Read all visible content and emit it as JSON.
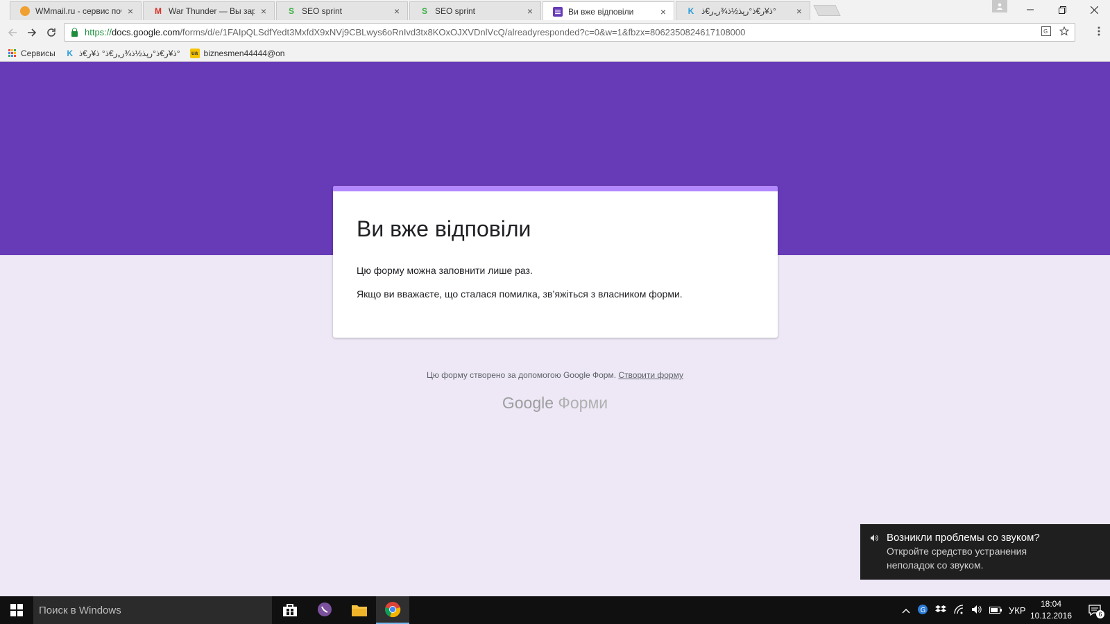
{
  "browser": {
    "tabs": [
      {
        "title": "WMmail.ru - сервис поч",
        "icon": "wmmail-icon",
        "color": "#f0a030"
      },
      {
        "title": "War Thunder — Вы заре",
        "icon": "gmail-icon",
        "color": "#d93025"
      },
      {
        "title": "SEO sprint",
        "icon": "seosprint-icon",
        "color": "#3cb043"
      },
      {
        "title": "SEO sprint",
        "icon": "seosprint-icon",
        "color": "#3cb043"
      },
      {
        "title": "Ви вже відповіли",
        "icon": "google-forms-icon",
        "color": "#673ab7"
      },
      {
        "title": "ذ¥ر€ذ°رپذ½ذ¾ر„ر€ذ°",
        "icon": "k-icon",
        "color": "#2d9cdb"
      }
    ],
    "url": {
      "scheme": "https://",
      "host": "docs.google.com",
      "path": "/forms/d/e/1FAIpQLSdfYedt3MxfdX9xNVj9CBLwys6oRnIvd3tx8KOxOJXVDnlVcQ/alreadyresponded?c=0&w=1&fbzx=8062350824617108000"
    },
    "bookmarks": [
      {
        "label": "Сервисы",
        "icon": "apps-grid-icon"
      },
      {
        "label": "ذ¥ر€ذ°رپذ½ذ¾ر„ر€ذ° ذ¥ر€ذ°",
        "icon": "k-icon"
      },
      {
        "label": "biznesmen44444@on",
        "icon": "ua-icon"
      }
    ],
    "favicon_text": {
      "k": "K",
      "ua": "ua"
    }
  },
  "form": {
    "title": "Ви вже відповіли",
    "line1": "Цю форму можна заповнити лише раз.",
    "line2": "Якщо ви вважаєте, що сталася помилка, зв’яжіться з власником форми.",
    "footer_text": "Цю форму створено за допомогою Google Форм.",
    "footer_link": "Створити форму",
    "logo_google": "Google",
    "logo_forms": "Форми"
  },
  "toast": {
    "title": "Возникли проблемы со звуком?",
    "body": "Откройте средство устранения неполадок со звуком."
  },
  "taskbar": {
    "search_placeholder": "Поиск в Windows",
    "language": "УКР",
    "time": "18:04",
    "date": "10.12.2016",
    "notification_count": "6"
  },
  "colors": {
    "banner": "#673ab7",
    "accent_strip": "#b388ff",
    "page_bg": "#ede7f6"
  }
}
